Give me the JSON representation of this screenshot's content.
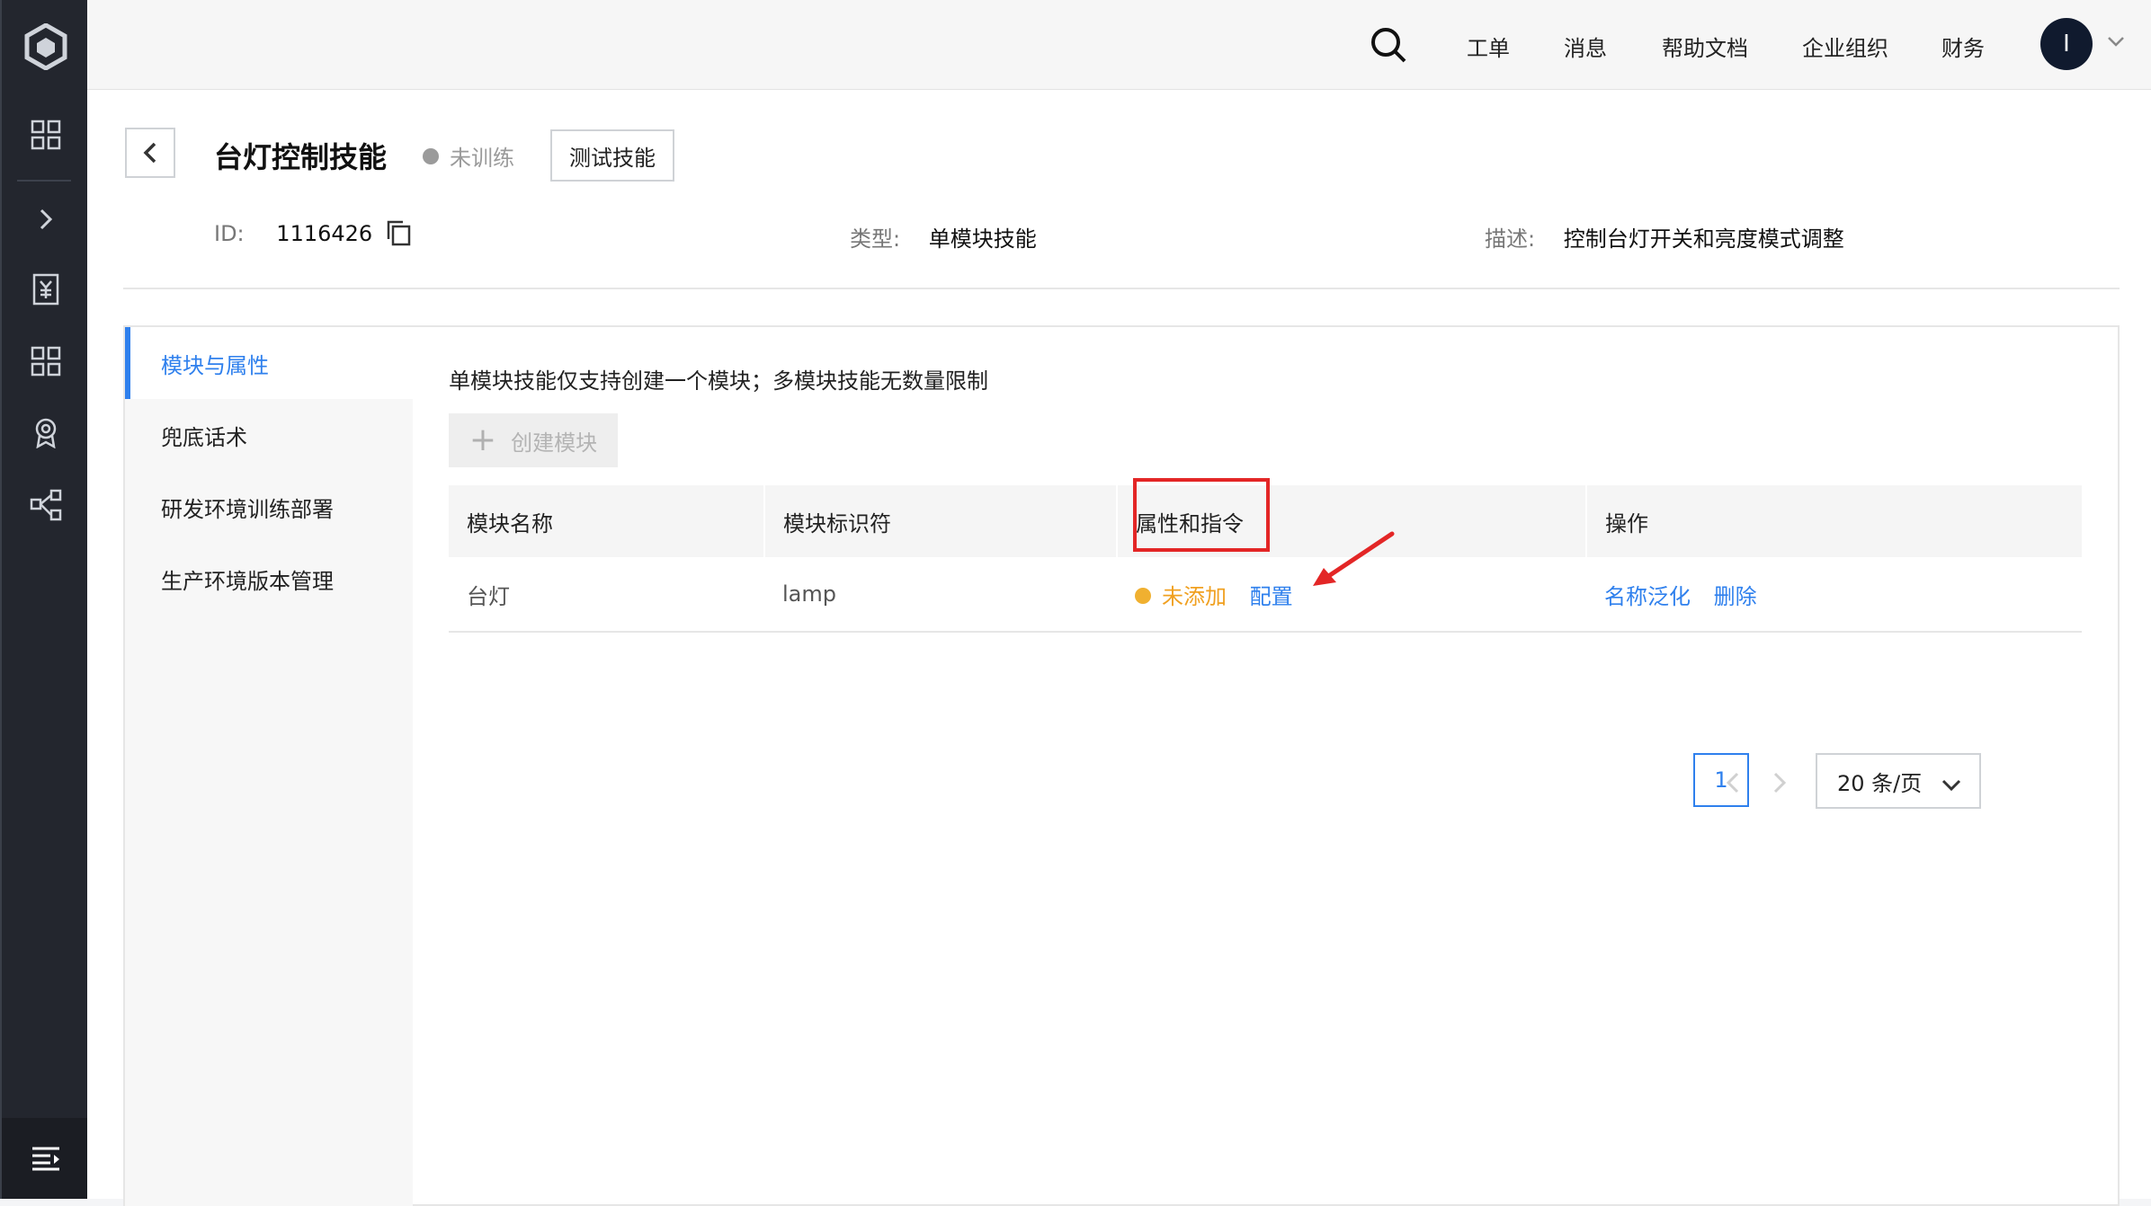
{
  "header": {
    "nav": [
      "工单",
      "消息",
      "帮助文档",
      "企业组织",
      "财务"
    ],
    "avatar_initial": "I"
  },
  "page": {
    "title": "台灯控制技能",
    "status": "未训练",
    "test_button": "测试技能",
    "meta": {
      "id_label": "ID:",
      "id_value": "1116426",
      "type_label": "类型:",
      "type_value": "单模块技能",
      "desc_label": "描述:",
      "desc_value": "控制台灯开关和亮度模式调整"
    }
  },
  "subnav": {
    "items": [
      "模块与属性",
      "兜底话术",
      "研发环境训练部署",
      "生产环境版本管理"
    ],
    "active": "模块与属性"
  },
  "content": {
    "hint": "单模块技能仅支持创建一个模块；多模块技能无数量限制",
    "create_button": "创建模块",
    "table": {
      "headers": [
        "模块名称",
        "模块标识符",
        "属性和指令",
        "操作"
      ],
      "rows": [
        {
          "name": "台灯",
          "identifier": "lamp",
          "attr_status": "未添加",
          "attr_action": "配置",
          "actions": [
            "名称泛化",
            "删除"
          ]
        }
      ]
    },
    "pagination": {
      "current_page": "1",
      "page_size": "20 条/页"
    }
  },
  "colors": {
    "accent": "#2f80ed",
    "warning": "#f0a020",
    "annotation": "#e32626",
    "rail": "#23262e"
  }
}
